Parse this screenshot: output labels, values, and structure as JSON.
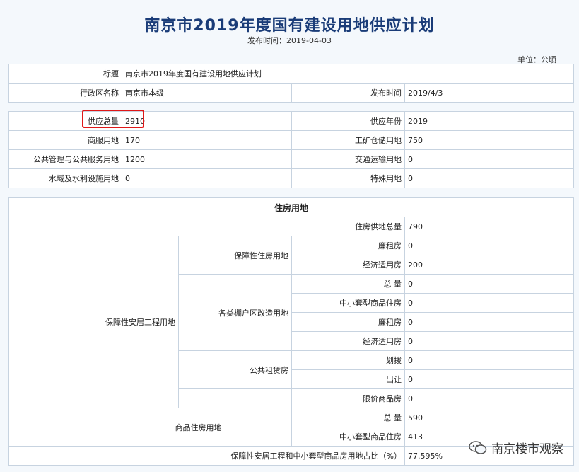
{
  "header": {
    "title": "南京市2019年度国有建设用地供应计划",
    "publish_label": "发布时间：",
    "publish_date": "2019-04-03",
    "unit_label": "单位：",
    "unit_value": "公顷"
  },
  "info": {
    "title_label": "标题",
    "title_value": "南京市2019年度国有建设用地供应计划",
    "region_label": "行政区名称",
    "region_value": "南京市本级",
    "date_label": "发布时间",
    "date_value": "2019/4/3"
  },
  "supply": {
    "total_label": "供应总量",
    "total_value": "2910",
    "year_label": "供应年份",
    "year_value": "2019",
    "commercial_label": "商服用地",
    "commercial_value": "170",
    "industrial_label": "工矿仓储用地",
    "industrial_value": "750",
    "public_label": "公共管理与公共服务用地",
    "public_value": "1200",
    "transport_label": "交通运输用地",
    "transport_value": "0",
    "water_label": "水域及水利设施用地",
    "water_value": "0",
    "special_label": "特殊用地",
    "special_value": "0"
  },
  "housing": {
    "section_title": "住房用地",
    "total_label": "住房供地总量",
    "total_value": "790",
    "affordable_project_label": "保障性安居工程用地",
    "guarantee_label": "保障性住房用地",
    "lowrent_label": "廉租房",
    "lowrent_value": "0",
    "economic_label": "经济适用房",
    "economic_value": "200",
    "shanty_label": "各类棚户区改造用地",
    "shanty_total_label": "总 量",
    "shanty_total_value": "0",
    "shanty_small_label": "中小套型商品住房",
    "shanty_small_value": "0",
    "shanty_lowrent_label": "廉租房",
    "shanty_lowrent_value": "0",
    "shanty_economic_label": "经济适用房",
    "shanty_economic_value": "0",
    "rental_label": "公共租赁房",
    "rental_alloc_label": "划拨",
    "rental_alloc_value": "0",
    "rental_transfer_label": "出让",
    "rental_transfer_value": "0",
    "limited_label": "限价商品房",
    "limited_value": "0",
    "commercial_housing_label": "商品住房用地",
    "commercial_total_label": "总 量",
    "commercial_total_value": "590",
    "commercial_small_label": "中小套型商品住房",
    "commercial_small_value": "413",
    "ratio_label": "保障性安居工程和中小套型商品房用地占比（%）",
    "ratio_value": "77.595%"
  },
  "watermark": {
    "text": "南京楼市观察",
    "icon": "wechat-icon"
  }
}
